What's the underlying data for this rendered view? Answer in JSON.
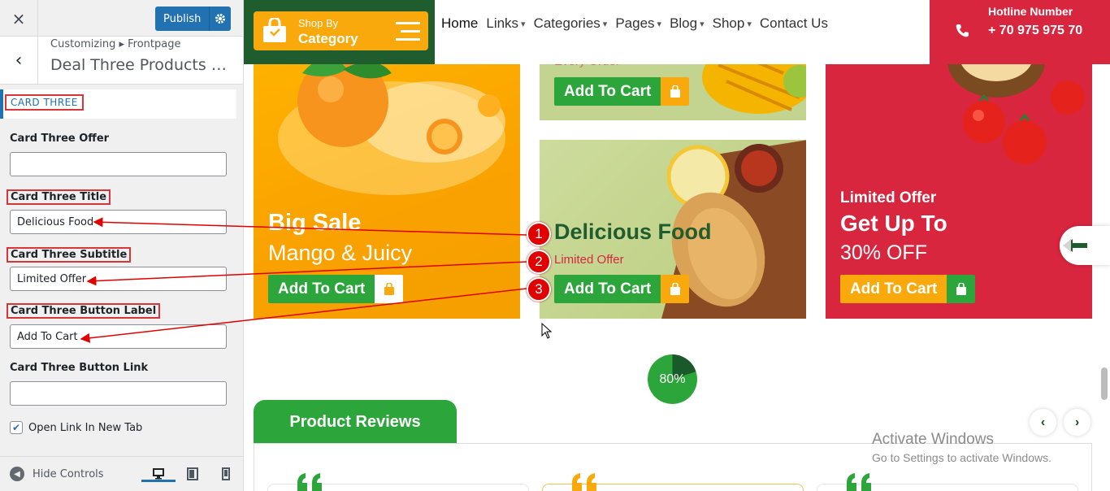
{
  "sidebar": {
    "close_icon": "×",
    "publish_label": "Publish",
    "breadcrumb": "Customizing ▸ Frontpage",
    "section_title": "Deal Three Products Sec...",
    "section_heading": "CARD THREE",
    "fields": [
      {
        "label": "Card Three Offer",
        "value": ""
      },
      {
        "label": "Card Three Title",
        "value": "Delicious Food"
      },
      {
        "label": "Card Three Subtitle",
        "value": "Limited Offer"
      },
      {
        "label": "Card Three Button Label",
        "value": "Add To Cart"
      },
      {
        "label": "Card Three Button Link",
        "value": ""
      }
    ],
    "checkbox_label": "Open Link In New Tab",
    "checkbox_checked": true,
    "hide_controls_label": "Hide Controls"
  },
  "nav": {
    "shopby_line1": "Shop By",
    "shopby_line2": "Category",
    "menu": [
      "Home",
      "Links",
      "Categories",
      "Pages",
      "Blog",
      "Shop",
      "Contact Us"
    ],
    "hotline_label": "Hotline Number",
    "hotline_number": "+ 70 975 975 70"
  },
  "cards": {
    "top_cut_text": "Every Order",
    "card1": {
      "title": "Big Sale",
      "subtitle": "Mango & Juicy",
      "button": "Add To Cart"
    },
    "card_top_mid": {
      "button": "Add To Cart"
    },
    "card3": {
      "title": "Delicious Food",
      "subtitle": "Limited Offer",
      "button": "Add To Cart"
    },
    "card_red": {
      "offer": "Limited Offer",
      "title": "Get Up To",
      "subtitle": "30% OFF",
      "button": "Add To Cart"
    }
  },
  "progress": {
    "label": "80%",
    "value": 0.8
  },
  "reviews": {
    "title": "Product Reviews"
  },
  "annotations": [
    "1",
    "2",
    "3"
  ],
  "windows_watermark": {
    "line1": "Activate Windows",
    "line2": "Go to Settings to activate Windows."
  },
  "colors": {
    "accent_green": "#2ca63b",
    "accent_orange": "#f9a90c",
    "accent_red": "#d8263f",
    "wp_blue": "#2271b1",
    "annotation_red": "#e00000"
  }
}
